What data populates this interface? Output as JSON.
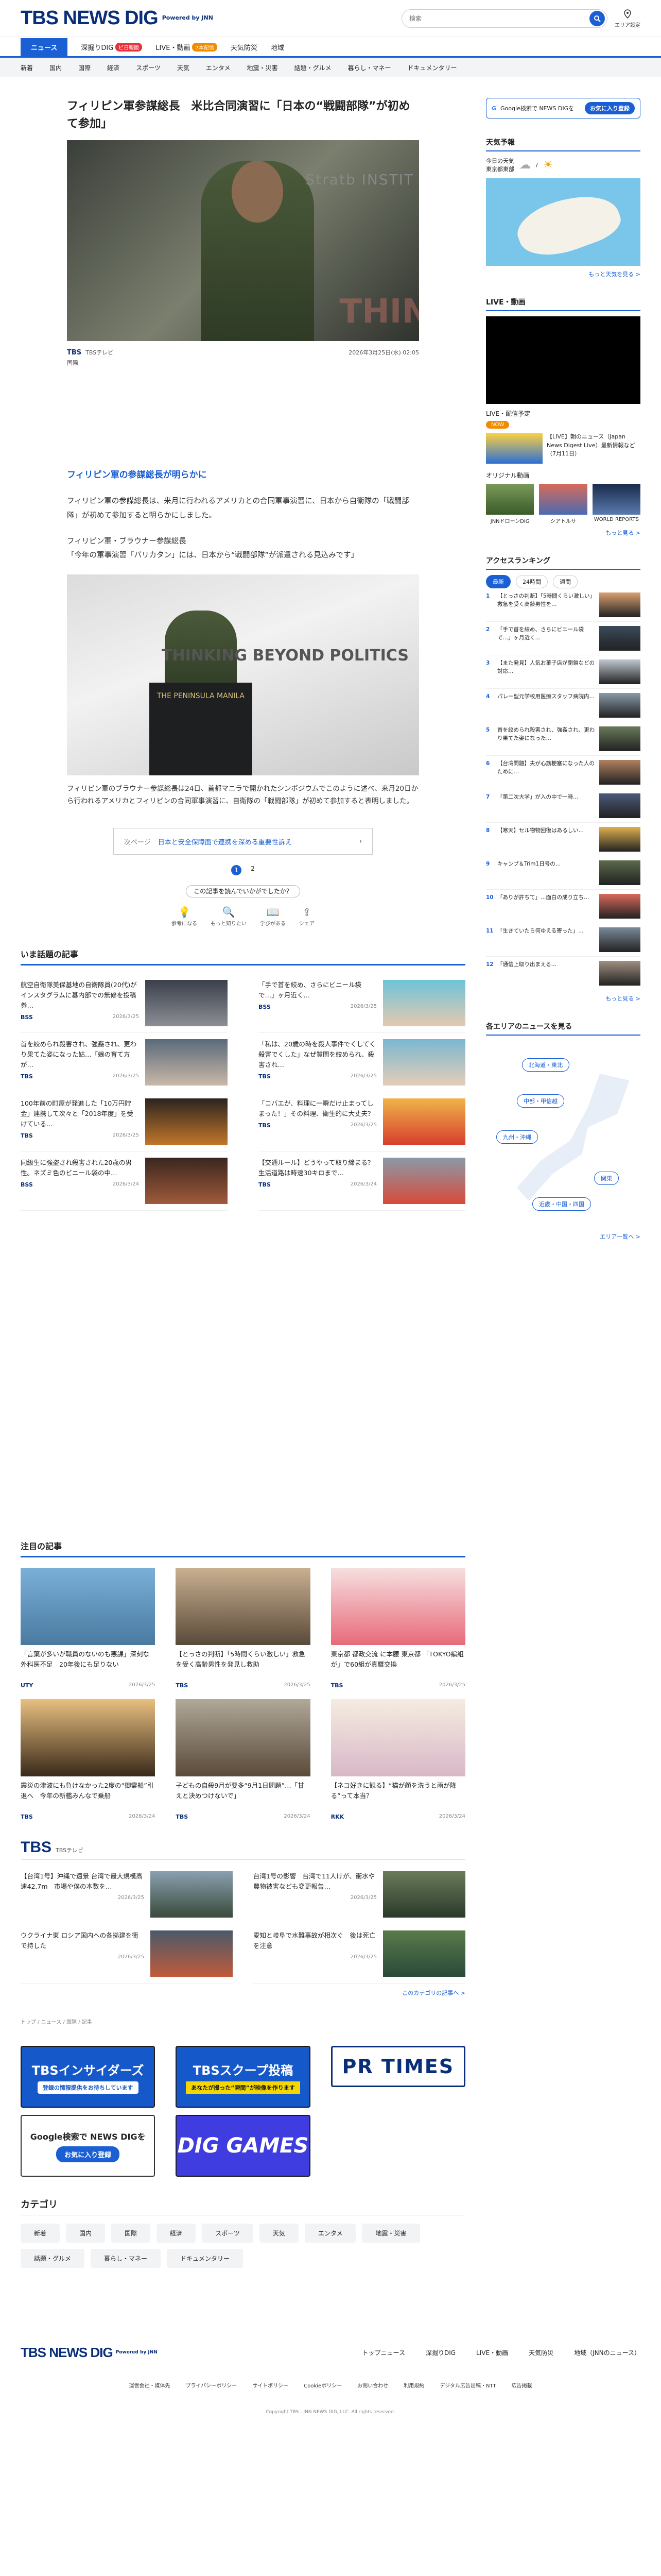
{
  "header": {
    "logo": "TBS NEWS DIG",
    "powered": "Powered by JNN",
    "search_placeholder": "検索",
    "area_label": "エリア設定"
  },
  "nav_primary": [
    {
      "label": "ニュース",
      "active": true
    },
    {
      "label": "深掘りDIG",
      "badge": "ビ日報版"
    },
    {
      "label": "LIVE・動画",
      "badge2": "7本配信"
    },
    {
      "label": "天気防災"
    },
    {
      "label": "地域"
    }
  ],
  "nav_secondary": [
    "新着",
    "国内",
    "国際",
    "経済",
    "スポーツ",
    "天気",
    "エンタメ",
    "地震・災害",
    "話題・グルメ",
    "暮らし・マネー",
    "ドキュメンタリー"
  ],
  "article": {
    "title": "フィリピン軍参謀総長　米比合同演習に「日本の“戦闘部隊”が初めて参加」",
    "hero_text": "Stratb INSTIT",
    "hero_text2": "THIN",
    "source": "TBSテレビ",
    "date": "2026年3月25日(水) 02:05",
    "tag": "国際",
    "heading": "フィリピン軍の参謀総長が明らかに",
    "p1": "フィリピン軍の参謀総長は、来月に行われるアメリカとの合同軍事演習に、日本から自衛隊の「戦闘部隊」が初めて参加すると明らかにしました。",
    "p2": "フィリピン軍・ブラウナー参謀総長\n「今年の軍事演習「バリカタン」には、日本から“戦闘部隊”が派遣される見込みです」",
    "img2_text": "THINKING BEYOND POLITICS",
    "img2_podium": "THE PENINSULA MANILA",
    "caption": "フィリピン軍のブラウナー参謀総長は24日、首都マニラで開かれたシンポジウムでこのように述べ、来月20日から行われるアメリカとフィリピンの合同軍事演習に、自衛隊の「戦闘部隊」が初めて参加すると表明しました。",
    "next_label": "次ページ",
    "next_text": "日本と安全保障面で連携を深める重要性訴え",
    "pages": [
      "1",
      "2"
    ],
    "question": "この記事を読んでいかがでしたか？",
    "reactions": [
      "参考になる",
      "もっと知りたい",
      "学びがある",
      "シェア"
    ]
  },
  "topics_heading": "いま話題の記事",
  "topics": [
    {
      "title": "航空自衛隊美保基地の自衛隊員(20代)がインスタグラムに基内部での無修を投稿　券…",
      "src": "BSS",
      "date": "2026/3/25"
    },
    {
      "title": "「手で首を絞め、さらにビニール袋で…」ヶ月近く…",
      "src": "BSS",
      "date": "2026/3/25"
    },
    {
      "title": "首を絞められ殺害され、強姦され、更わり果てた姿になった姑…「娘の育て方が…",
      "src": "TBS",
      "date": "2026/3/25"
    },
    {
      "title": "「私は、20歳の時を殺人事件でくしてく殺害でくした」なぜ質問を絞められ、殺害され…",
      "src": "TBS",
      "date": "2026/3/25"
    },
    {
      "title": "100年前の町屋が発進した「10万円貯金」連携して次々と「2018年度」を受けている…",
      "src": "TBS",
      "date": "2026/3/25"
    },
    {
      "title": "「コバエが、料理に一瞬だけ止まってしまった！」その料理、衛生的に大丈夫？",
      "src": "TBS",
      "date": "2026/3/25"
    },
    {
      "title": "同級生に強盗され殺害された20歳の男性。ネズミ色のビニール袋の中…",
      "src": "BSS",
      "date": "2026/3/24"
    },
    {
      "title": "【交通ルール】どうやって取り締まる？生活道路は時速30キロまで…",
      "src": "TBS",
      "date": "2026/3/24"
    }
  ],
  "featured_heading": "注目の記事",
  "featured": [
    {
      "title": "「言葉が多いが職員のないのも悪課」深刻な外科医不足　20年後にも足りない",
      "src": "UTY",
      "date": "2026/3/25"
    },
    {
      "title": "【とっさの判断】「5時間くらい激しい」救急を受く高齢男性を発見し救助",
      "src": "TBS",
      "date": "2026/3/25"
    },
    {
      "title": "東京都 都政交流 に本腰 東京都 「TOKYO編組が」で60組が真贋交換",
      "src": "TBS",
      "date": "2026/3/25"
    },
    {
      "title": "震災の津波にも負けなかった2度の“御霊船”引退へ　今年の新艦みんなで乗船",
      "src": "TBS",
      "date": "2026/3/24"
    },
    {
      "title": "子どもの自殺9月が要多“9月1日問題”…「甘えと決めつけないで」",
      "src": "TBS",
      "date": "2026/3/24"
    },
    {
      "title": "【ネコ好きに観る】“猫が顔を洗うと雨が降る”って本当？",
      "src": "RKK",
      "date": "2026/3/24"
    }
  ],
  "tbs_section": {
    "title": "TBS",
    "sub": "TBSテレビ",
    "items": [
      {
        "title": "【台湾1号】沖縄で遠景 台湾で最大規模高速42.7m　市場や僕の本数を…",
        "date": "2026/3/25"
      },
      {
        "title": "台湾1号の影響　台湾で11人けが、衝水や農物被害なども変更報告…",
        "date": "2026/3/25"
      },
      {
        "title": "ウクライナ東 ロシア国内への各拠建を衝で持した",
        "date": "2026/3/25"
      },
      {
        "title": "愛知と岐阜で水難事故が相次ぐ　後は死亡を注意",
        "date": "2026/3/25"
      }
    ],
    "more": "このカテゴリの記事へ >"
  },
  "breadcrumb": "トップ / ニュース / 国際 / 記事",
  "banners": {
    "b1": "TBSインサイダーズ",
    "b1_sub": "登録の情報提供をお待ちしています",
    "b2": "TBSスクープ投稿",
    "b2_sub": "あなたが撮った“瞬間”が映像を作ります",
    "b3": "PR TIMES",
    "b4": "Google検索で NEWS DIGを",
    "b4_sub": "お気に入り登録",
    "b5": "DIG GAMES"
  },
  "category_heading": "カテゴリ",
  "categories": [
    "新着",
    "国内",
    "国際",
    "経済",
    "スポーツ",
    "天気",
    "エンタメ",
    "地震・災害",
    "話題・グルメ",
    "暮らし・マネー",
    "ドキュメンタリー"
  ],
  "footer": {
    "logo": "TBS NEWS DIG",
    "links1": [
      "トップニュース",
      "深掘りDIG",
      "LIVE・動画",
      "天気防災",
      "地域（JNNのニュース）"
    ],
    "links2": [
      "運営会社・媒体先",
      "プライバシーポリシー",
      "サイトポリシー",
      "Cookieポリシー",
      "お問い合わせ",
      "利用規約",
      "デジタル広告出稿・NTT",
      "広告掲載"
    ],
    "copyright": "Copyright TBS - JNN NEWS DIG, LLC. All rights reserved."
  },
  "sidebar": {
    "fav_text": "Google検索で NEWS DIGを",
    "fav_btn": "お気に入り登録",
    "weather_heading": "天気予報",
    "weather_today": "今日の天気",
    "weather_region": "東京都東部",
    "weather_more": "もっと天気を見る >",
    "live_heading": "LIVE・動画",
    "live_label": "LIVE・配信予定",
    "now": "NOW",
    "live_item": "【LIVE】朝のニュース（Japan News Digest Live）最新情報など（7月11日）",
    "orig_label": "オリジナル動画",
    "orig": [
      "JNNドローンDIG",
      "シアトルサ",
      "WORLD REPORTS"
    ],
    "live_more": "もっと見る >",
    "rank_heading": "アクセスランキング",
    "rank_tabs": [
      "最新",
      "24時間",
      "週間"
    ],
    "rank": [
      "【とっさの判断】「5時間くらい激しい」救急を受く高齢男性を…",
      "「手で首を絞め、さらにビニール袋で…」ヶ月近く…",
      "【また発見】人気お菓子店が閉鎖などの対応…",
      "パレー型元学校用医療スタッフ病院内…",
      "首を絞められ殺害され、強姦され、更わり果てた姿になった…",
      "【台湾問題】夫が心筋梗塞になった人のために…",
      "「第二次大学」が入の中で一時…",
      "【寒天】セル物物回復はあるしい…",
      "キャンプ＆Trim1日号の…",
      "「ありが許ちて」…面白の成り立ち…",
      "「生きていたら何ゆえる寄った」…",
      "「通信上取り出まえる…"
    ],
    "rank_more": "もっと見る >",
    "area_heading": "各エリアのニュースを見る",
    "areas": [
      "北海道・東北",
      "中部・甲信越",
      "九州・沖縄",
      "関東",
      "近畿・中国・四国"
    ],
    "area_more": "エリア一覧へ >"
  }
}
